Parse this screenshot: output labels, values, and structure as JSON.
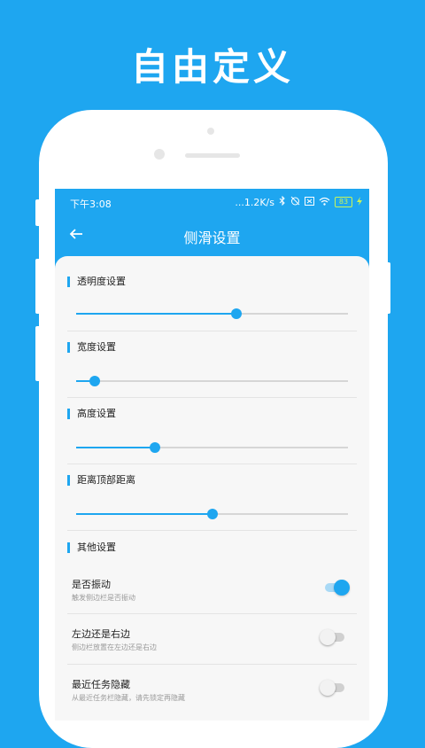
{
  "headline": "自由定义",
  "status": {
    "time": "下午3:08",
    "speed": "...1.2K/s",
    "battery": "83"
  },
  "appbar": {
    "title": "侧滑设置"
  },
  "sliders": [
    {
      "label": "透明度设置",
      "value": 0.59
    },
    {
      "label": "宽度设置",
      "value": 0.07
    },
    {
      "label": "高度设置",
      "value": 0.29
    },
    {
      "label": "距离顶部距离",
      "value": 0.5
    }
  ],
  "other": {
    "title": "其他设置",
    "items": [
      {
        "label": "是否振动",
        "desc": "触发侧边栏是否振动",
        "on": true
      },
      {
        "label": "左边还是右边",
        "desc": "侧边栏放置在左边还是右边",
        "on": false
      },
      {
        "label": "最近任务隐藏",
        "desc": "从最近任务栏隐藏，请先锁定再隐藏",
        "on": false
      }
    ]
  },
  "colors": {
    "accent": "#1ea6f0",
    "background": "#1ea6f0",
    "card": "#f7f7f7"
  }
}
